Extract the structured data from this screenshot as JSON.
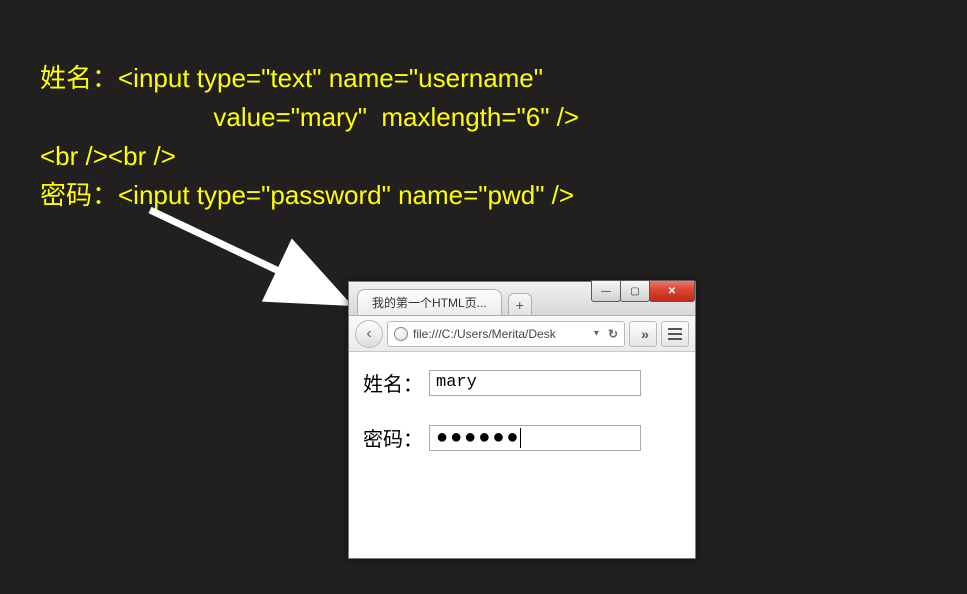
{
  "code": {
    "line1": "姓名：<input type=\"text\" name=\"username\"",
    "line2": "                        value=\"mary\"  maxlength=\"6\" />",
    "line3": "<br /><br />",
    "line4": "密码：<input type=\"password\" name=\"pwd\" />"
  },
  "browser": {
    "tab_title": "我的第一个HTML页...",
    "new_tab_label": "+",
    "url": "file:///C:/Users/Merita/Desk",
    "dropdown_glyph": "▾",
    "reload_glyph": "↻",
    "more_glyph": "»",
    "back_glyph": "‹",
    "min_glyph": "—",
    "max_glyph": "▢",
    "close_glyph": "✕"
  },
  "form": {
    "username_label": "姓名：",
    "username_value": "mary",
    "password_label": "密码：",
    "password_dots": "●●●●●●"
  }
}
